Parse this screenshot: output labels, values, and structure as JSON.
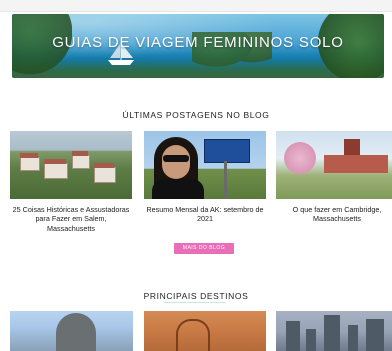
{
  "hero": {
    "title": "GUIAS DE VIAGEM FEMININOS SOLO"
  },
  "blog": {
    "heading": "ÚLTIMAS POSTAGENS NO BLOG",
    "posts": [
      {
        "title": "25 Coisas Históricas e Assustadoras para Fazer em Salem, Massachusetts"
      },
      {
        "title": "Resumo Mensal da AK: setembro de 2021"
      },
      {
        "title": "O que fazer em Cambridge, Massachusetts"
      }
    ],
    "more_button": "MAIS DO BLOG"
  },
  "destinos": {
    "heading": "PRINCIPAIS DESTINOS"
  },
  "colors": {
    "accent_pink": "#e86fb7",
    "heading_text": "#222222"
  }
}
